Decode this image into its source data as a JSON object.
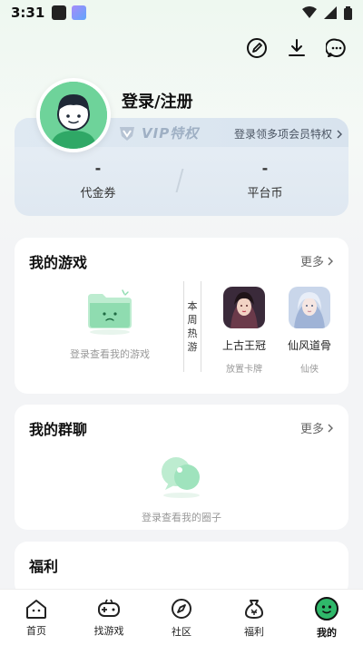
{
  "status_bar": {
    "time": "3:31"
  },
  "profile": {
    "login_title": "登录/注册"
  },
  "vip": {
    "badge": "VIP特权",
    "link": "登录领多项会员特权",
    "stats": [
      {
        "value": "-",
        "label": "代金券"
      },
      {
        "value": "-",
        "label": "平台币"
      }
    ]
  },
  "my_games": {
    "title": "我的游戏",
    "more": "更多",
    "empty_text": "登录查看我的游戏",
    "weekly_hot": [
      "本",
      "周",
      "热",
      "游"
    ],
    "games": [
      {
        "name": "上古王冠",
        "tag": "放置卡牌"
      },
      {
        "name": "仙风道骨",
        "tag": "仙侠"
      }
    ]
  },
  "my_groups": {
    "title": "我的群聊",
    "more": "更多",
    "empty_text": "登录查看我的圈子"
  },
  "welfare": {
    "title": "福利"
  },
  "nav": [
    {
      "label": "首页"
    },
    {
      "label": "找游戏"
    },
    {
      "label": "社区"
    },
    {
      "label": "福利"
    },
    {
      "label": "我的"
    }
  ],
  "colors": {
    "accent": "#2fb86a",
    "vip_text": "#9fb0c4"
  }
}
